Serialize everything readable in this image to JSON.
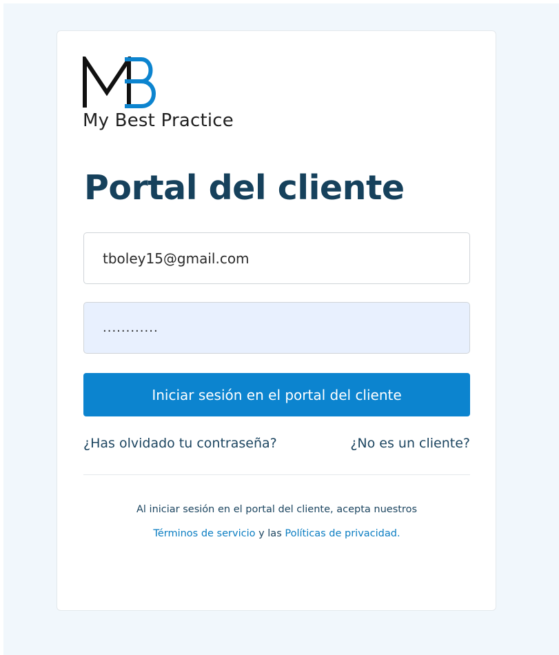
{
  "brand": {
    "logo_text": "My Best Practice",
    "logo_letters": "MB",
    "colors": {
      "primary_dark": "#16415c",
      "accent_blue": "#0c84cf",
      "link_blue": "#0a7dc2",
      "page_background": "#f1f7fc",
      "autofill_background": "#e8f0fe"
    }
  },
  "login": {
    "title": "Portal del cliente",
    "email_value": "tboley15@gmail.com",
    "password_value": "............",
    "submit_label": "Iniciar sesión en el portal del cliente",
    "forgot_password_label": "¿Has olvidado tu contraseña?",
    "not_client_label": "¿No es un cliente?"
  },
  "legal": {
    "line1": "Al iniciar sesión en el portal del cliente, acepta nuestros",
    "terms_label": "Términos de servicio",
    "connector": " y las ",
    "privacy_label": "Políticas de privacidad."
  }
}
